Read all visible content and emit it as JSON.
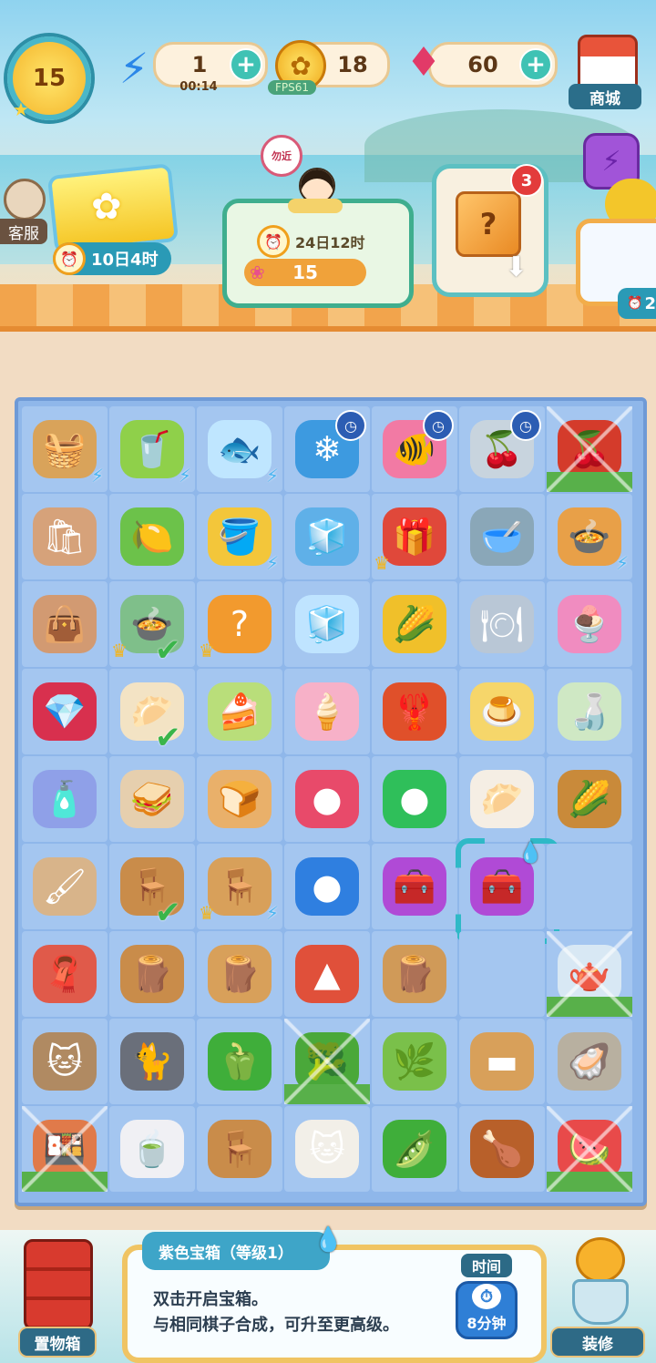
{
  "top_bar": {
    "level": "15",
    "energy": {
      "value": "1",
      "timer": "00:14"
    },
    "coins": "18",
    "gems": "60",
    "fps": "FPS61",
    "shop_label": "商城",
    "service_label": "客服"
  },
  "events": {
    "ticket_timer": "10日4时",
    "kid_fan_text": "勿近",
    "kid_timer": "24日12时",
    "kid_points": "15",
    "crate_badge": "3",
    "side_timer": "2"
  },
  "board": {
    "rows": [
      [
        {
          "name": "corn-basket",
          "glyph": "🧺",
          "bg": "#d9a35a",
          "bolt": true
        },
        {
          "name": "juicer",
          "glyph": "🥤",
          "bg": "#8fd04a",
          "bolt": true
        },
        {
          "name": "goldfish-bag",
          "glyph": "🐟",
          "bg": "#bfe6ff",
          "bolt": true
        },
        {
          "name": "fridge",
          "glyph": "❄",
          "bg": "#3d9ae0",
          "timer": true
        },
        {
          "name": "fish-cushion",
          "glyph": "🐠",
          "bg": "#f27aa4",
          "timer": true
        },
        {
          "name": "cherry-plate",
          "glyph": "🍒",
          "bg": "#c8d4de",
          "timer": true
        },
        {
          "name": "cherries",
          "glyph": "🍒",
          "bg": "#d43b2b",
          "web": true
        }
      ],
      [
        {
          "name": "paper-bag",
          "glyph": "🛍",
          "bg": "#d6a27a"
        },
        {
          "name": "citrus-press",
          "glyph": "🍋",
          "bg": "#6cc24a"
        },
        {
          "name": "golden-bucket",
          "glyph": "🪣",
          "bg": "#f3c63a",
          "bolt": true
        },
        {
          "name": "ice-bucket",
          "glyph": "🧊",
          "bg": "#5fb0e8"
        },
        {
          "name": "red-gift-box",
          "glyph": "🎁",
          "bg": "#e0483a",
          "crown": true
        },
        {
          "name": "porcelain-bowl",
          "glyph": "🥣",
          "bg": "#8aa7b8"
        },
        {
          "name": "soup-pot",
          "glyph": "🍲",
          "bg": "#e8a048",
          "bolt": true
        }
      ],
      [
        {
          "name": "closed-paper-bag",
          "glyph": "👜",
          "bg": "#d29a72"
        },
        {
          "name": "corn-soup",
          "glyph": "🍲",
          "bg": "#7fbf8a",
          "crown": true,
          "tick": true
        },
        {
          "name": "mystery-cube",
          "glyph": "?",
          "bg": "#f29a2e",
          "crown": true
        },
        {
          "name": "ice-cubes",
          "glyph": "🧊",
          "bg": "#bfe4ff"
        },
        {
          "name": "corn",
          "glyph": "🌽",
          "bg": "#f0c02a"
        },
        {
          "name": "flower-dish",
          "glyph": "🍽",
          "bg": "#b9c7d6"
        },
        {
          "name": "dessert-bowl",
          "glyph": "🍨",
          "bg": "#f08cc0"
        }
      ],
      [
        {
          "name": "red-gems",
          "glyph": "💎",
          "bg": "#d8304e"
        },
        {
          "name": "steamed-bun",
          "glyph": "🥟",
          "bg": "#f3e3c4",
          "tick": true
        },
        {
          "name": "matcha-cake",
          "glyph": "🍰",
          "bg": "#b9de7a"
        },
        {
          "name": "ice-cream-cone",
          "glyph": "🍦",
          "bg": "#f7b1c8"
        },
        {
          "name": "lobster-platter",
          "glyph": "🦞",
          "bg": "#e0502a"
        },
        {
          "name": "egg-custard",
          "glyph": "🍮",
          "bg": "#f6d66a"
        },
        {
          "name": "sake-bottle",
          "glyph": "🍶",
          "bg": "#cfe8c4"
        }
      ],
      [
        {
          "name": "glue-tube",
          "glyph": "🧴",
          "bg": "#8fa0e8"
        },
        {
          "name": "sandwich",
          "glyph": "🥪",
          "bg": "#e6cfae"
        },
        {
          "name": "sesame-bun",
          "glyph": "🍞",
          "bg": "#e9b06a"
        },
        {
          "name": "red-bubble-orb",
          "glyph": "●",
          "bg": "#e84a6a"
        },
        {
          "name": "green-bubble-orb",
          "glyph": "●",
          "bg": "#2fbf5a"
        },
        {
          "name": "pork-bun",
          "glyph": "🥟",
          "bg": "#f5eee4"
        },
        {
          "name": "corn-basket-steamer",
          "glyph": "🌽",
          "bg": "#c98a3a"
        }
      ],
      [
        {
          "name": "paint-brush",
          "glyph": "🖌",
          "bg": "#d8b48a"
        },
        {
          "name": "wooden-chair",
          "glyph": "🪑",
          "bg": "#c98c4a",
          "tick": true
        },
        {
          "name": "wooden-bench",
          "glyph": "🪑",
          "bg": "#d8a05a",
          "crown": true,
          "bolt": true
        },
        {
          "name": "blue-bubble-orb",
          "glyph": "●",
          "bg": "#2f7fe0"
        },
        {
          "name": "purple-chest",
          "glyph": "🧰",
          "bg": "#b04ad6"
        },
        {
          "name": "purple-chest-selected",
          "glyph": "🧰",
          "bg": "#b04ad6",
          "selected": true
        },
        {
          "name": "empty",
          "glyph": "",
          "bg": "transparent"
        }
      ],
      [
        {
          "name": "red-cloth",
          "glyph": "🧣",
          "bg": "#e05a4a"
        },
        {
          "name": "wooden-table",
          "glyph": "🪵",
          "bg": "#c98c4a"
        },
        {
          "name": "wood-planks",
          "glyph": "🪵",
          "bg": "#d8a05a"
        },
        {
          "name": "red-powder",
          "glyph": "▲",
          "bg": "#e0503a"
        },
        {
          "name": "wood-board",
          "glyph": "🪵",
          "bg": "#d09a58"
        },
        {
          "name": "empty",
          "glyph": "",
          "bg": "transparent"
        },
        {
          "name": "teapot",
          "glyph": "🫖",
          "bg": "#d8e8f4",
          "web": true
        }
      ],
      [
        {
          "name": "tabby-cat",
          "glyph": "🐱",
          "bg": "#b08a62"
        },
        {
          "name": "grey-cat",
          "glyph": "🐈",
          "bg": "#6a6f7a"
        },
        {
          "name": "green-pepper",
          "glyph": "🫑",
          "bg": "#3fae3a"
        },
        {
          "name": "broccoli",
          "glyph": "🥦",
          "bg": "#4aa83a",
          "web": true
        },
        {
          "name": "green-onions",
          "glyph": "🌿",
          "bg": "#7ac04a"
        },
        {
          "name": "wood-stick",
          "glyph": "▬",
          "bg": "#d8a05a"
        },
        {
          "name": "oysters",
          "glyph": "🦪",
          "bg": "#b8b0a0"
        }
      ],
      [
        {
          "name": "grill-plate",
          "glyph": "🍱",
          "bg": "#e07a4a",
          "web": true
        },
        {
          "name": "tea-bag",
          "glyph": "🍵",
          "bg": "#f0f0f4"
        },
        {
          "name": "wooden-chair-2",
          "glyph": "🪑",
          "bg": "#c98c4a"
        },
        {
          "name": "calico-cat",
          "glyph": "🐱",
          "bg": "#f2efe8"
        },
        {
          "name": "pea-pods",
          "glyph": "🫛",
          "bg": "#3fae3a"
        },
        {
          "name": "roast-dish",
          "glyph": "🍗",
          "bg": "#b8602a"
        },
        {
          "name": "watermelon-slice",
          "glyph": "🍉",
          "bg": "#e84a4a",
          "web": true
        }
      ]
    ]
  },
  "info": {
    "title": "紫色宝箱（等级1）",
    "line1": "双击开启宝箱。",
    "line2": "与相同棋子合成，可升至更高级。",
    "time_label": "时间",
    "time_value": "8分钟"
  },
  "bottom": {
    "storage_label": "置物箱",
    "decorate_label": "装修"
  },
  "colors": {
    "board_bg": "#8fb7ea",
    "cell_bg": "#a4c6f0",
    "accent_teal": "#3fc2b4",
    "panel_border": "#f0c463"
  }
}
